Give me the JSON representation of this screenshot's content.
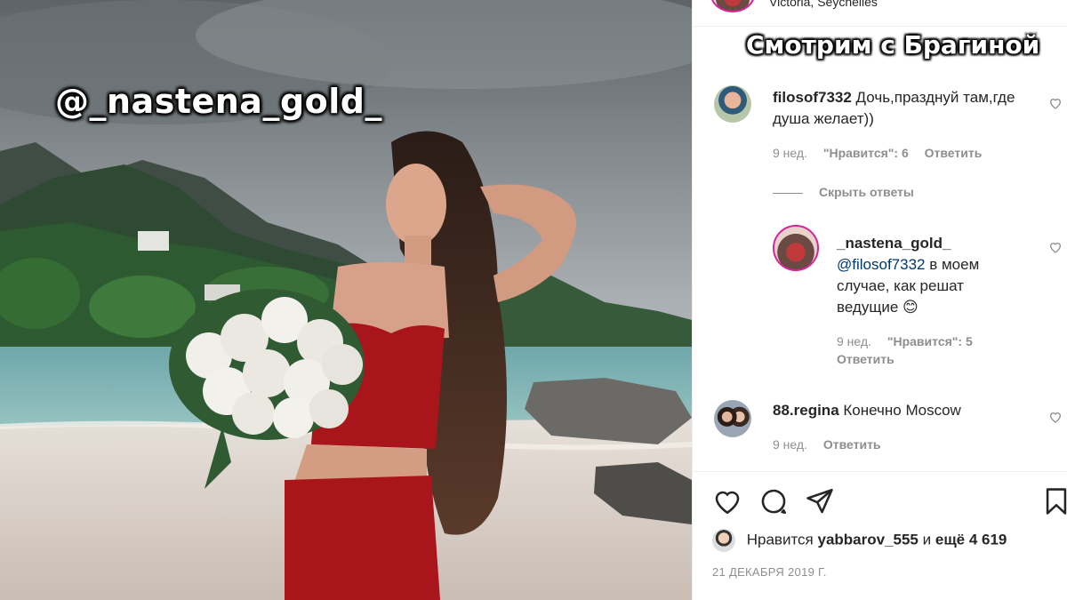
{
  "photo": {
    "overlay_handle": "@_nastena_gold_"
  },
  "post": {
    "location": "Victoria, Seychelles",
    "watermark": "Смотрим с Брагиной"
  },
  "comments": [
    {
      "user": "filosof7332",
      "text": "Дочь,празднуй там,где душа желает))",
      "age": "9 нед.",
      "likes": "\"Нравится\": 6",
      "reply": "Ответить"
    }
  ],
  "hide_replies": "Скрыть ответы",
  "reply": {
    "user": "_nastena_gold_",
    "mention": "@filosof7332",
    "text": "в моем случае, как решат ведущие 😊",
    "age": "9 нед.",
    "likes": "\"Нравится\": 5",
    "reply": "Ответить"
  },
  "comment2": {
    "user": "88.regina",
    "text": "Конечно Moscow",
    "age": "9 нед.",
    "reply": "Ответить"
  },
  "likes": {
    "prefix": "Нравится",
    "user": "yabbarov_555",
    "connector": "и",
    "others": "ещё 4 619"
  },
  "date": "21 ДЕКАБРЯ 2019 Г.",
  "icons": {
    "like": "heart-icon",
    "comment": "comment-icon",
    "share": "send-icon",
    "save": "bookmark-icon"
  }
}
